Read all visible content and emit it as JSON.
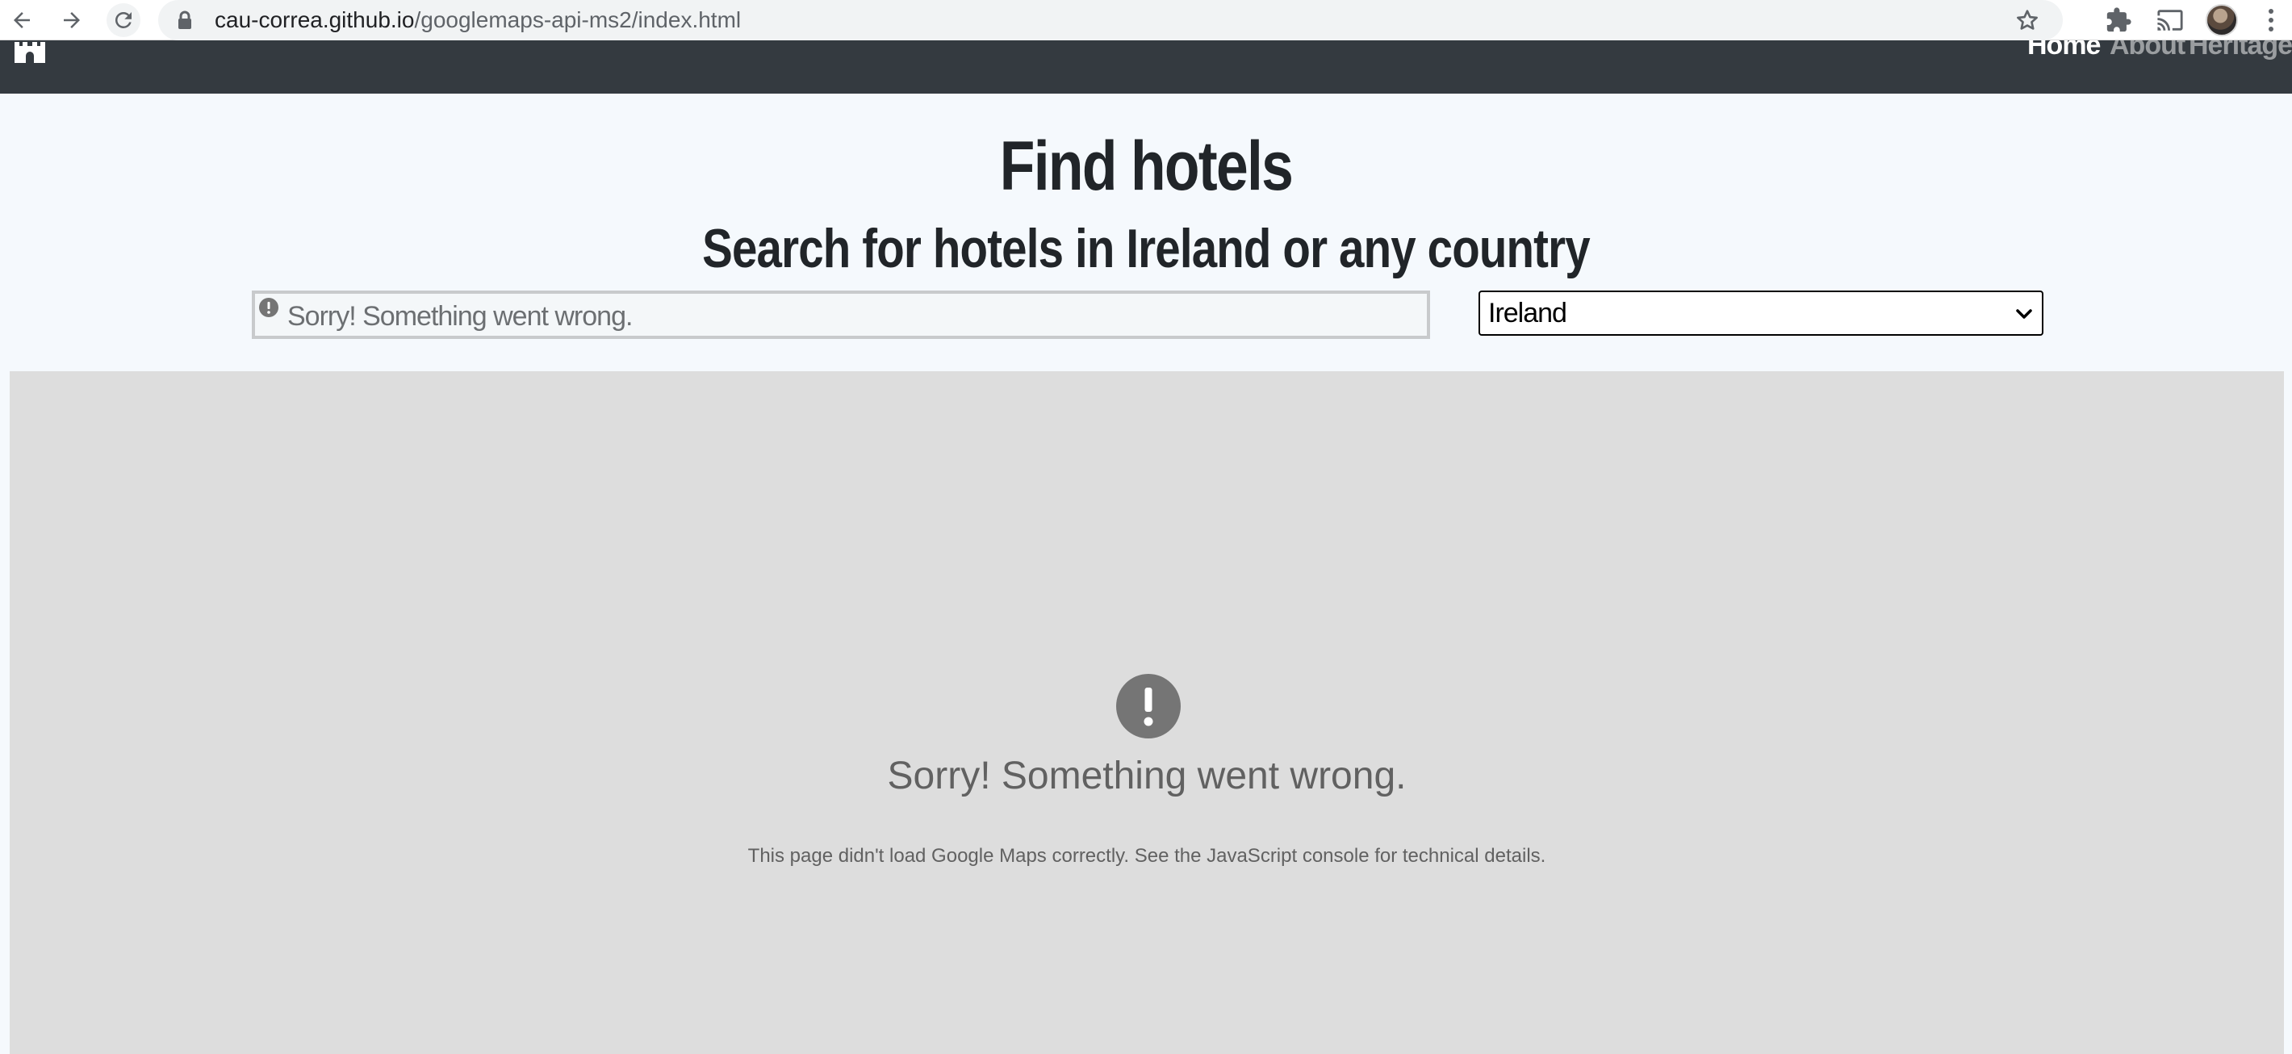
{
  "browser": {
    "url_host": "cau-correa.github.io",
    "url_path": "/googlemaps-api-ms2/index.html",
    "icons": {
      "back": "arrow-left-icon",
      "forward": "arrow-right-icon",
      "reload": "reload-icon",
      "lock": "lock-icon",
      "bookmark": "star-icon",
      "extensions": "puzzle-icon",
      "cast": "cast-icon",
      "menu": "kebab-menu-icon"
    }
  },
  "navbar": {
    "brand_icon": "castle-icon",
    "links": [
      {
        "label": "Home",
        "active": true
      },
      {
        "label": "About",
        "active": false
      },
      {
        "label": "Heritage",
        "active": false
      }
    ],
    "background": "#343a40"
  },
  "header": {
    "title": "Find hotels",
    "subtitle": "Search for hotels in Ireland or any country"
  },
  "search": {
    "error_text": "Sorry! Something went wrong.",
    "error_icon": "exclamation-circle-icon"
  },
  "country_select": {
    "selected": "Ireland"
  },
  "map": {
    "error_title": "Sorry! Something went wrong.",
    "error_detail": "This page didn't load Google Maps correctly. See the JavaScript console for technical details.",
    "error_icon": "exclamation-circle-icon",
    "background": "#dddddd"
  }
}
